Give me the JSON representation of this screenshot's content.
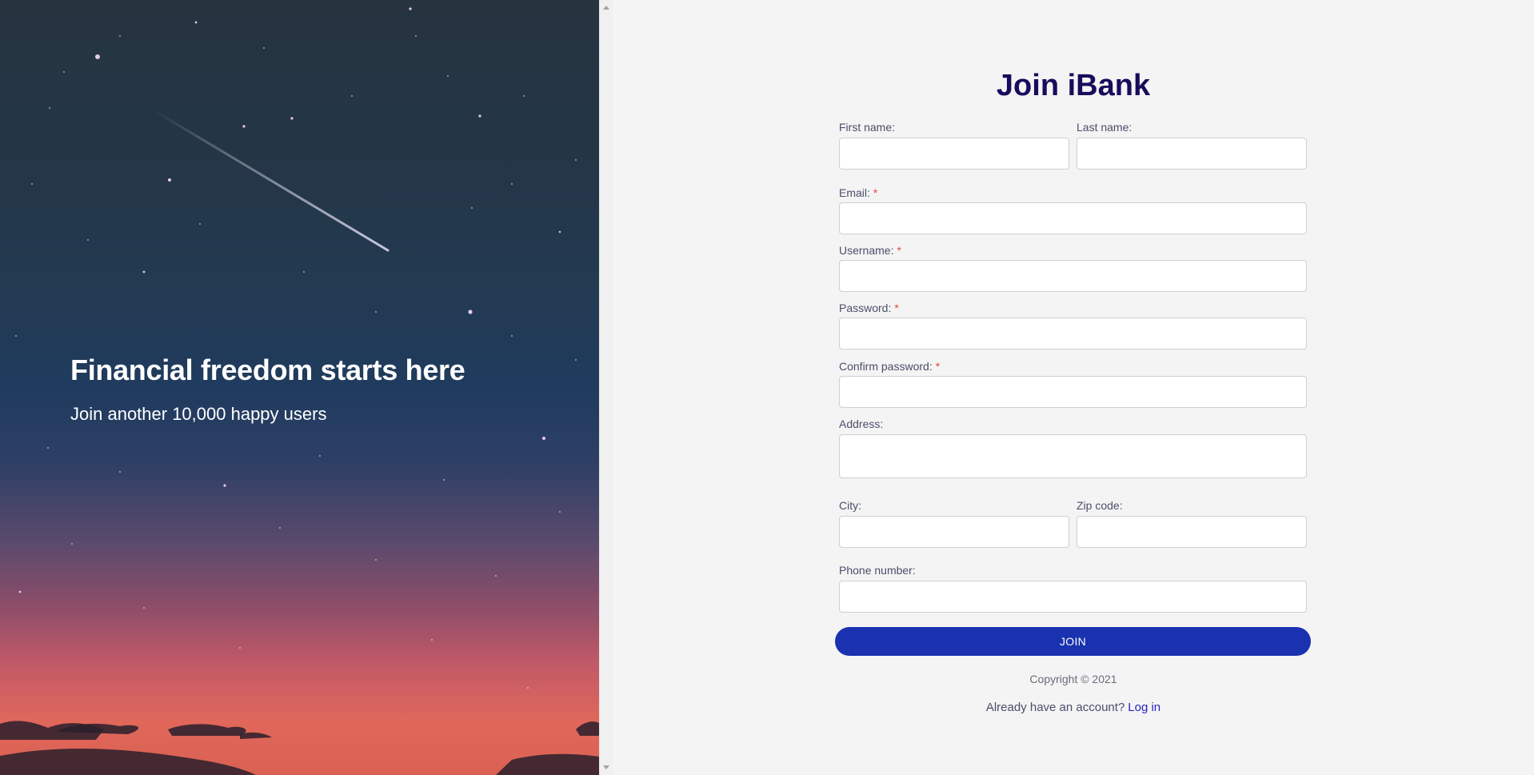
{
  "hero": {
    "title": "Financial freedom starts here",
    "subtitle": "Join another 10,000 happy users"
  },
  "form": {
    "title": "Join iBank",
    "required_mark": "*",
    "fields": {
      "first_name": {
        "label": "First name:",
        "value": ""
      },
      "last_name": {
        "label": "Last name:",
        "value": ""
      },
      "email": {
        "label": "Email:",
        "value": ""
      },
      "username": {
        "label": "Username:",
        "value": ""
      },
      "password": {
        "label": "Password:",
        "value": ""
      },
      "confirm_password": {
        "label": "Confirm password:",
        "value": ""
      },
      "address": {
        "label": "Address:",
        "value": ""
      },
      "city": {
        "label": "City:",
        "value": ""
      },
      "zip_code": {
        "label": "Zip code:",
        "value": ""
      },
      "phone_number": {
        "label": "Phone number:",
        "value": ""
      }
    },
    "submit_label": "JOIN",
    "copyright": "Copyright © 2021",
    "login_prompt": "Already have an account?",
    "login_link": "Log in"
  },
  "colors": {
    "title": "#1a0b5c",
    "button": "#1a31b0",
    "link": "#2525c4",
    "required": "#e0483f",
    "page_background": "#f4f4f4"
  }
}
